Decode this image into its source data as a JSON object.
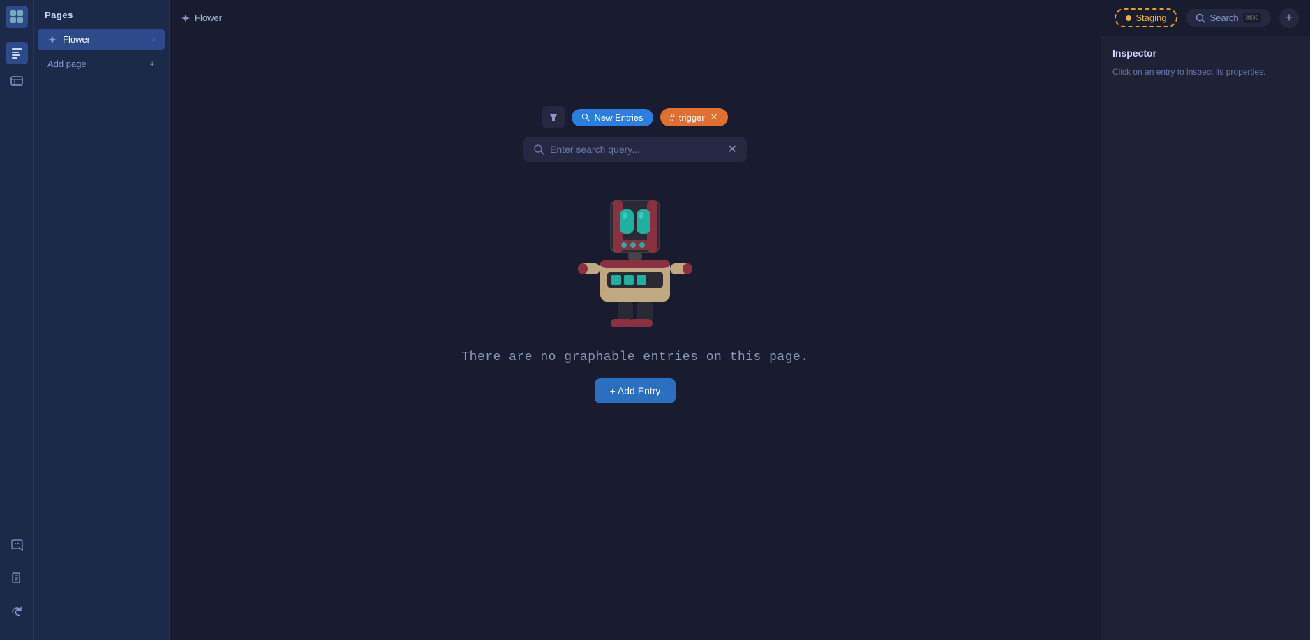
{
  "app": {
    "logo_icon": "grid-icon"
  },
  "icon_rail": {
    "icons": [
      {
        "name": "pages-icon",
        "symbol": "⊞",
        "active": true
      },
      {
        "name": "entries-icon",
        "symbol": "☰",
        "active": false
      }
    ],
    "bottom_icons": [
      {
        "name": "discord-icon",
        "symbol": "ⓓ"
      },
      {
        "name": "docs-icon",
        "symbol": "📄"
      },
      {
        "name": "refresh-icon",
        "symbol": "↻"
      }
    ]
  },
  "sidebar": {
    "title": "Pages",
    "items": [
      {
        "label": "Flower",
        "icon": "flower-icon",
        "active": true,
        "has_chevron": true
      }
    ],
    "add_label": "Add page",
    "add_icon": "plus-icon"
  },
  "topbar": {
    "breadcrumb_icon": "flower-icon",
    "breadcrumb_label": "Flower",
    "staging_label": "Staging",
    "search_label": "Search",
    "search_kbd": "⌘K",
    "plus_label": "+"
  },
  "filter_bar": {
    "filter_icon": "▼",
    "chip_new_entries": {
      "icon": "🔍",
      "label": "New Entries"
    },
    "chip_trigger": {
      "icon": "#",
      "label": "trigger",
      "has_close": true
    }
  },
  "search": {
    "placeholder": "Enter search query...",
    "value": ""
  },
  "empty_state": {
    "message": "There are no graphable entries on this page.",
    "add_entry_label": "+ Add Entry"
  },
  "inspector": {
    "title": "Inspector",
    "hint": "Click on an entry to inspect its properties."
  }
}
